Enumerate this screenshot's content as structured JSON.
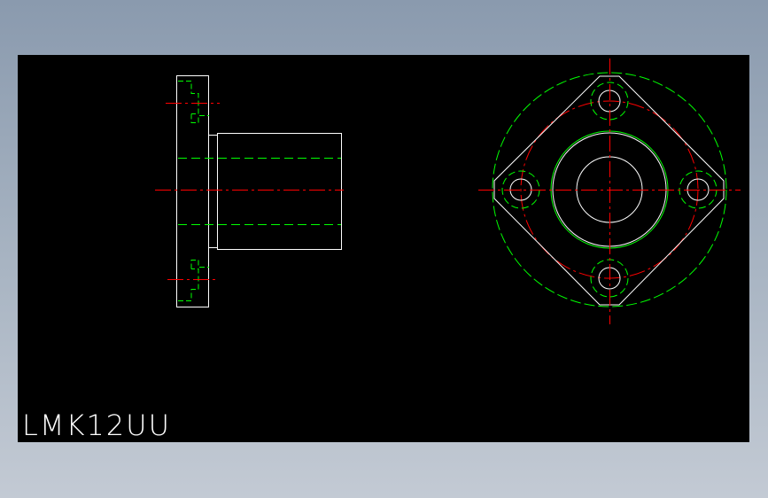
{
  "drawing": {
    "part_label": "LMK12UU",
    "colors": {
      "background": "#000000",
      "outline": "#ffffff",
      "hidden": "#00ff00",
      "center": "#ff0000"
    }
  }
}
